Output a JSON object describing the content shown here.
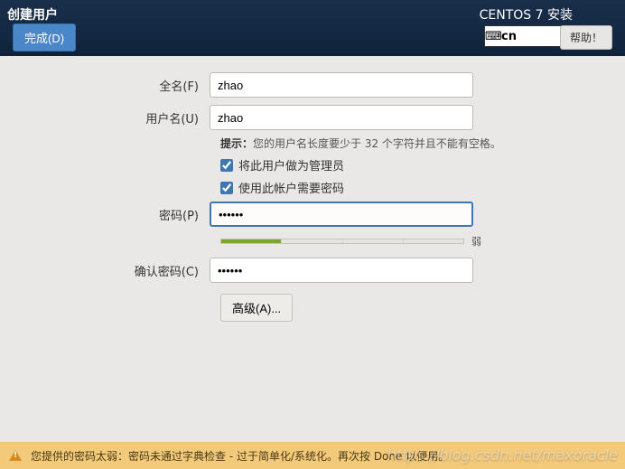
{
  "header": {
    "title_left": "创建用户",
    "title_right": "CENTOS 7 安装",
    "done_label": "完成(D)",
    "help_label": "帮助！",
    "lang_code": "cn"
  },
  "form": {
    "fullname_label": "全名(F)",
    "fullname_value": "zhao",
    "username_label": "用户名(U)",
    "username_value": "zhao",
    "hint_prefix": "提示：",
    "hint_text": "您的用户名长度要少于 32 个字符并且不能有空格。",
    "check_admin": "将此用户做为管理员",
    "check_require_pw": "使用此帐户需要密码",
    "password_label": "密码(P)",
    "password_value": "••••••",
    "strength_text": "弱",
    "confirm_label": "确认密码(C)",
    "confirm_value": "••••••",
    "advanced_label": "高级(A)..."
  },
  "footer": {
    "warning": "您提供的密码太弱：密码未通过字典检查 - 过于简单化/系统化。再次按 Done 以便用。"
  },
  "watermark": "https://blog.csdn.net/maxoracle"
}
